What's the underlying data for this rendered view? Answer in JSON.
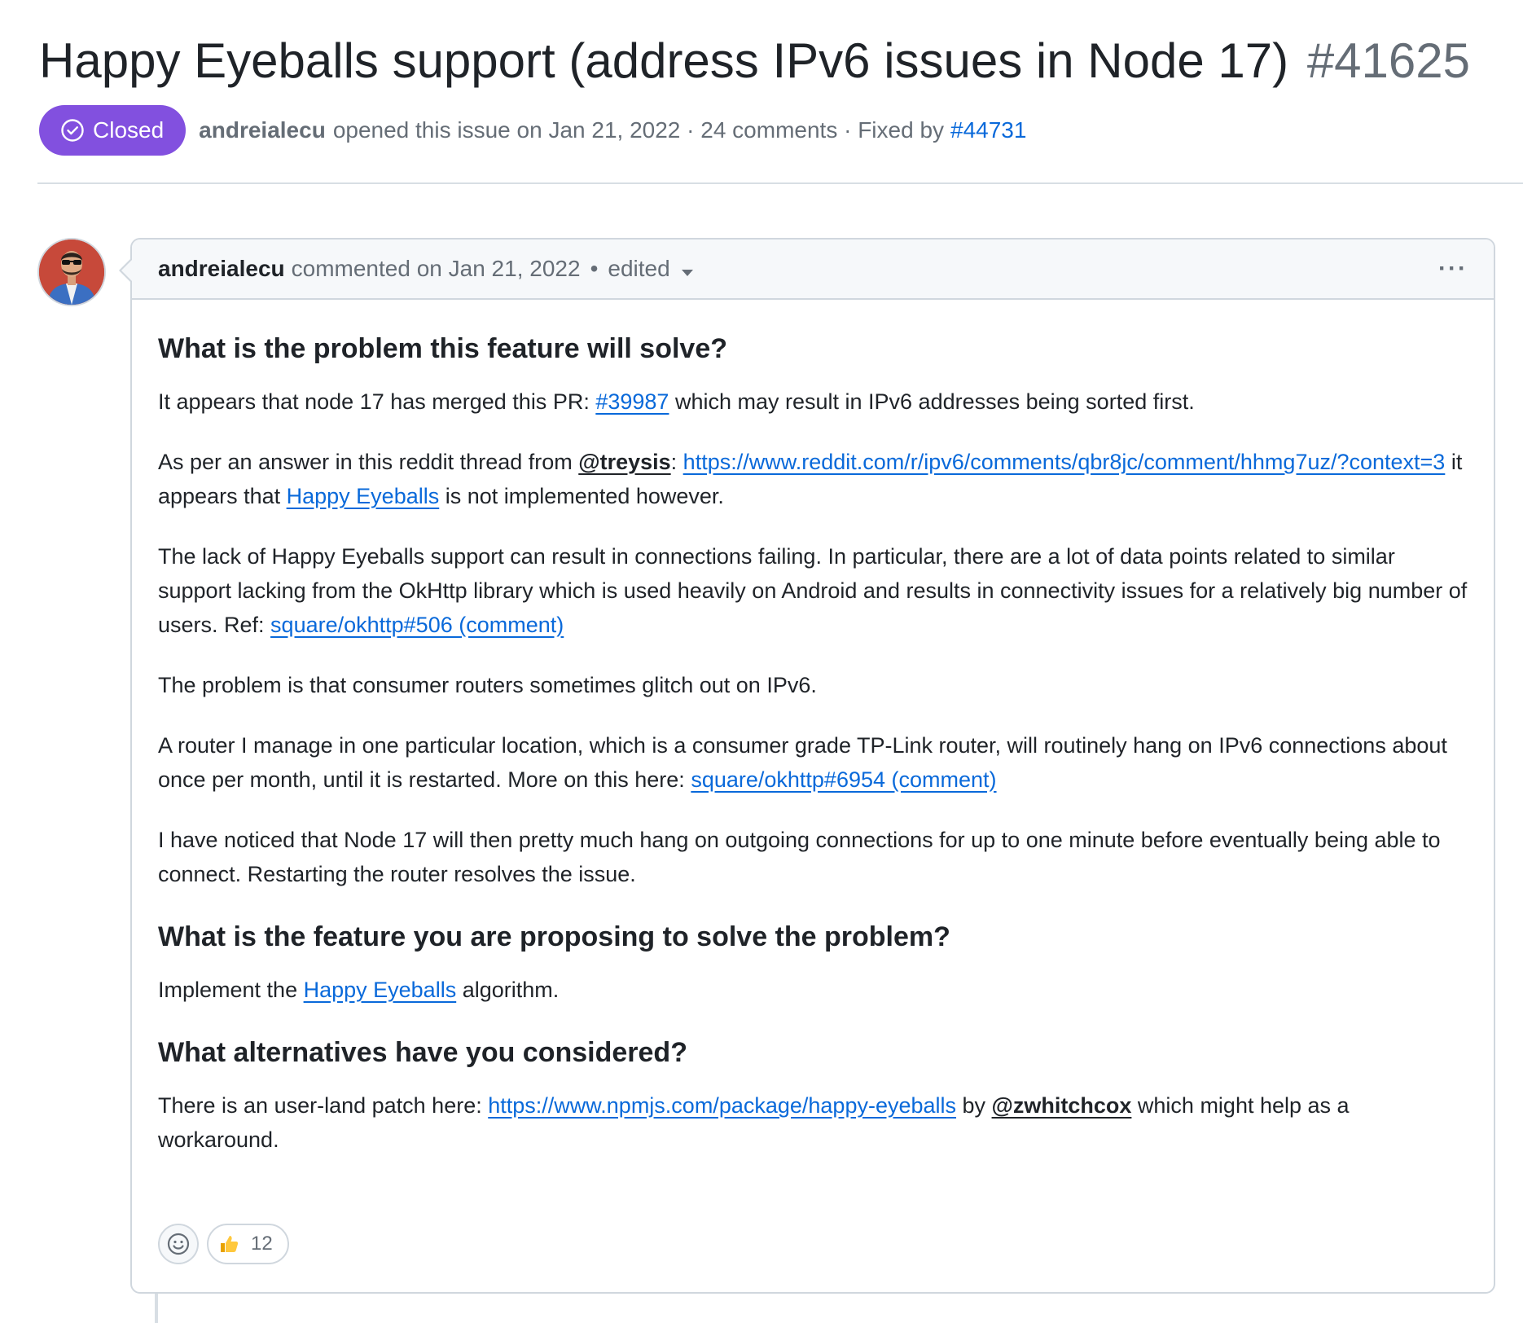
{
  "issue": {
    "title": "Happy Eyeballs support (address IPv6 issues in Node 17)",
    "number": "#41625",
    "state": "Closed",
    "author": "andreialecu",
    "opened_text": "opened this issue on Jan 21, 2022 · 24 comments · Fixed by",
    "fixed_by": "#44731"
  },
  "comment": {
    "author": "andreialecu",
    "commented_text": "commented on Jan 21, 2022",
    "separator": "•",
    "edited_label": "edited",
    "menu_label": "···",
    "h1": "What is the problem this feature will solve?",
    "p1": {
      "pre": "It appears that node 17 has merged this PR: ",
      "link": "#39987",
      "post": " which may result in IPv6 addresses being sorted first."
    },
    "p2": {
      "pre": "As per an answer in this reddit thread from ",
      "mention": "@treysis",
      "colon": ": ",
      "link": "https://www.reddit.com/r/ipv6/comments/qbr8jc/comment/hhmg7uz/?context=3",
      "mid": " it appears that ",
      "link2": "Happy Eyeballs",
      "post": " is not implemented however."
    },
    "p3": {
      "pre": "The lack of Happy Eyeballs support can result in connections failing. In particular, there are a lot of data points related to similar support lacking from the OkHttp library which is used heavily on Android and results in connectivity issues for a relatively big number of users. Ref: ",
      "link": "square/okhttp#506 (comment)"
    },
    "p4": "The problem is that consumer routers sometimes glitch out on IPv6.",
    "p5": {
      "pre": "A router I manage in one particular location, which is a consumer grade TP-Link router, will routinely hang on IPv6 connections about once per month, until it is restarted. More on this here: ",
      "link": "square/okhttp#6954 (comment)"
    },
    "p6": "I have noticed that Node 17 will then pretty much hang on outgoing connections for up to one minute before eventually being able to connect. Restarting the router resolves the issue.",
    "h2": "What is the feature you are proposing to solve the problem?",
    "p7": {
      "pre": "Implement the ",
      "link": "Happy Eyeballs",
      "post": " algorithm."
    },
    "h3": "What alternatives have you considered?",
    "p8": {
      "pre": "There is an user-land patch here: ",
      "link": "https://www.npmjs.com/package/happy-eyeballs",
      "mid": " by ",
      "mention": "@zwhitchcox",
      "post": " which might help as a workaround."
    },
    "reactions": {
      "thumbs_up_icon": "thumbs-up-icon",
      "thumbs_up_count": "12"
    }
  },
  "colors": {
    "closed_badge": "#8250df",
    "link": "#0969da",
    "muted_text": "#656d76",
    "border": "#d0d7de",
    "header_bg": "#f6f8fa"
  }
}
